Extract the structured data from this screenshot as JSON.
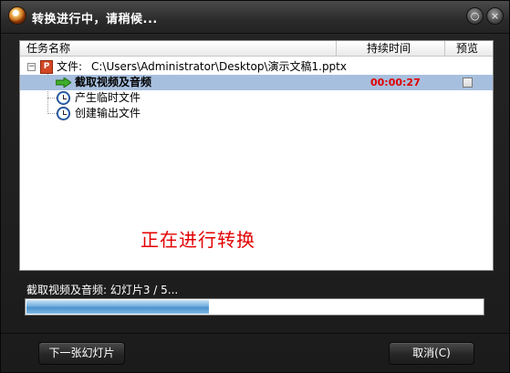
{
  "window": {
    "title": "转换进行中，请稍候...",
    "controls": {
      "minimize": "○",
      "close": "×"
    }
  },
  "table": {
    "columns": [
      "任务名称",
      "持续时间",
      "预览"
    ],
    "file": {
      "label": "文件:",
      "path": "C:\\Users\\Administrator\\Desktop\\演示文稿1.pptx",
      "icon": "pptx-icon",
      "expander": "−"
    },
    "tasks": [
      {
        "label": "截取视频及音频",
        "duration": "00:00:27",
        "icon": "green-arrow-icon",
        "active": true,
        "preview_checked": false
      },
      {
        "label": "产生临时文件",
        "icon": "clock-icon"
      },
      {
        "label": "创建输出文件",
        "icon": "clock-icon"
      }
    ]
  },
  "status_message": "正在进行转换",
  "progress": {
    "text": "截取视频及音频: 幻灯片3 / 5...",
    "fraction": 0.4
  },
  "buttons": {
    "next_slide": "下一张幻灯片",
    "cancel": "取消(C)"
  },
  "colors": {
    "selected_row": "#a7bfde",
    "duration": "#e00000",
    "status": "#e20000",
    "progress": "#4a8fcc"
  }
}
